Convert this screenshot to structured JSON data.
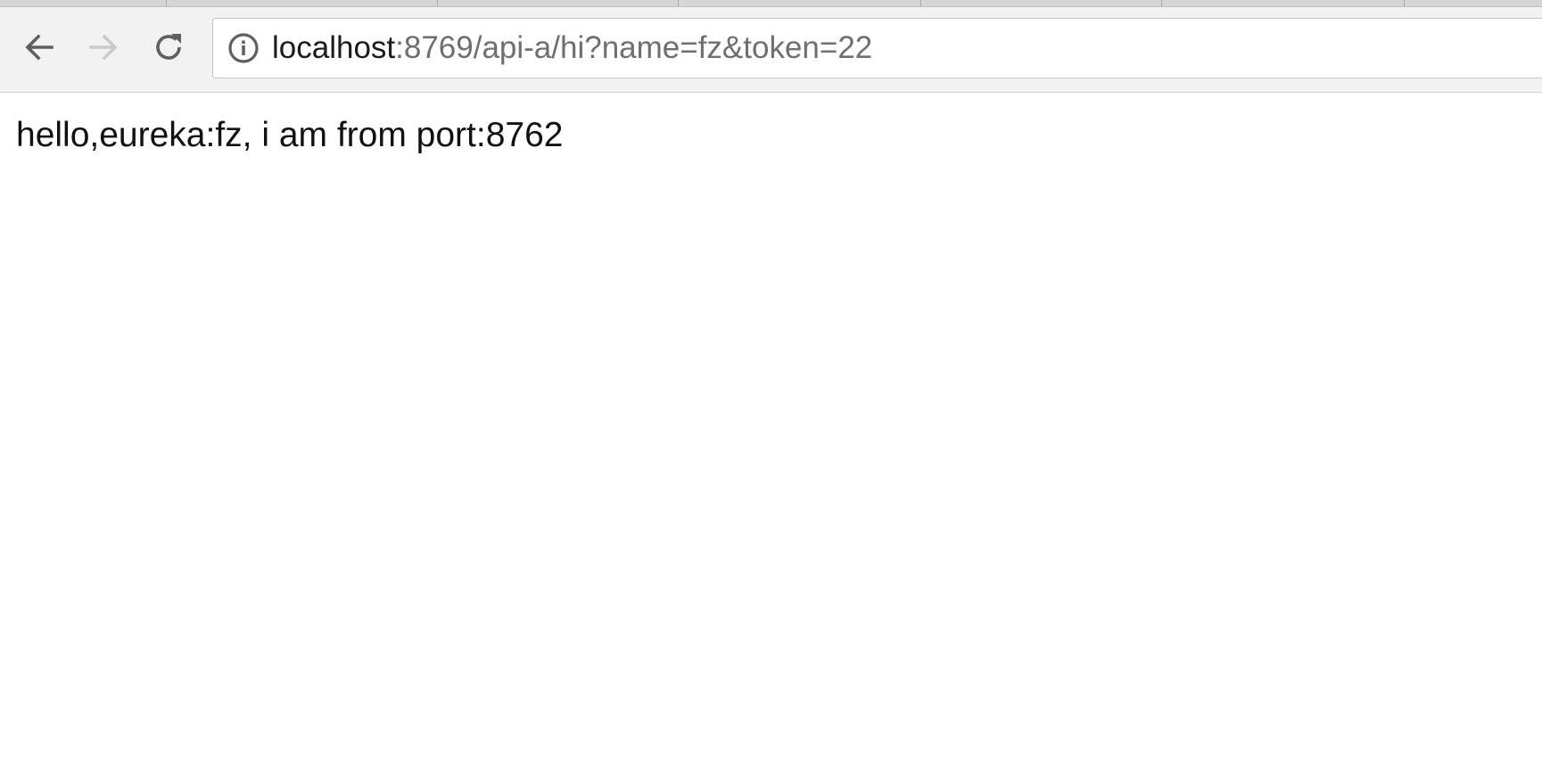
{
  "address_bar": {
    "host": "localhost",
    "rest": ":8769/api-a/hi?name=fz&token=22"
  },
  "page": {
    "body_text": "hello,eureka:fz, i am from port:8762"
  },
  "icons": {
    "back": "arrow-left",
    "forward": "arrow-right",
    "reload": "reload",
    "site_info": "info-circle"
  }
}
